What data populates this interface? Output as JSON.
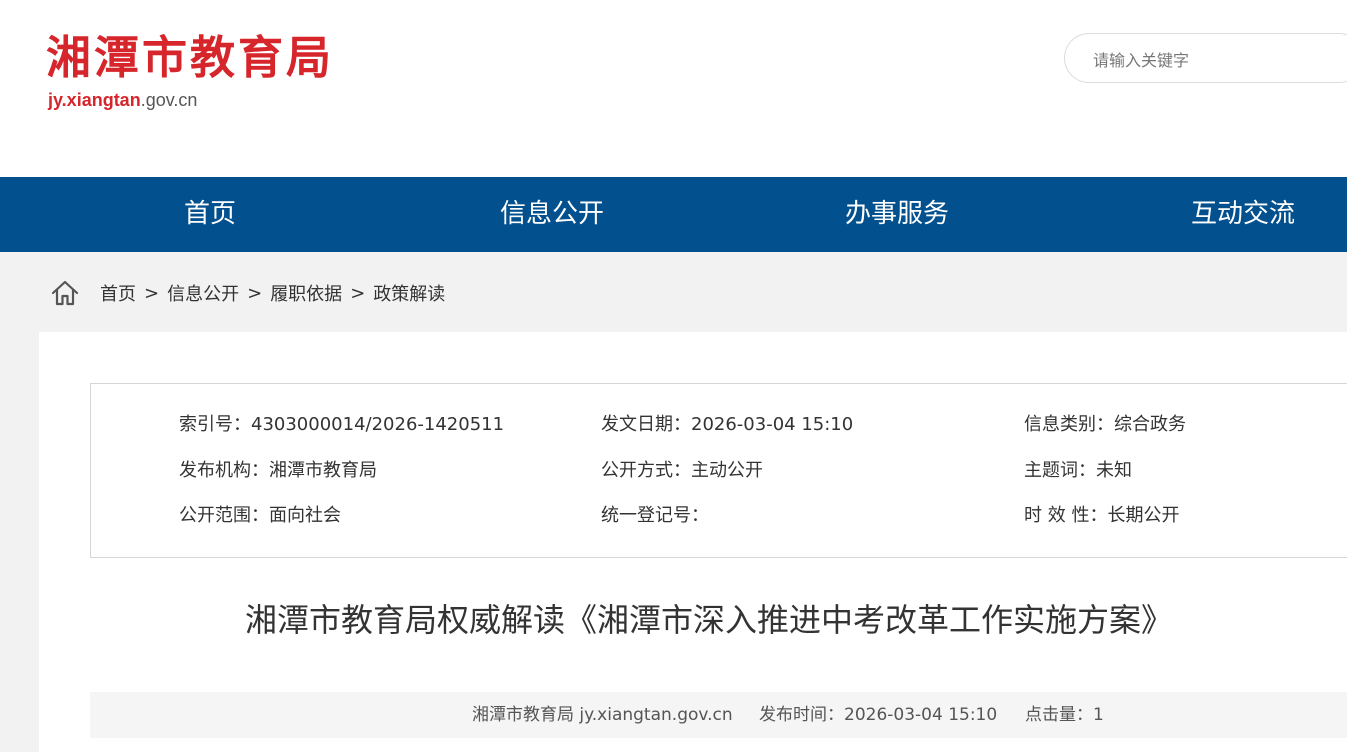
{
  "header": {
    "logo_title": "湘潭市教育局",
    "logo_domain_main": "jy.xiangtan",
    "logo_domain_suffix": ".gov.cn",
    "search_placeholder": "请输入关键字",
    "colors": {
      "brand_red": "#d6262c"
    }
  },
  "nav": {
    "items": [
      {
        "label": "首页"
      },
      {
        "label": "信息公开"
      },
      {
        "label": "办事服务"
      },
      {
        "label": "互动交流"
      }
    ],
    "colors": {
      "background": "#03508f"
    }
  },
  "breadcrumb": {
    "icon": "home-icon",
    "items": [
      "首页",
      "信息公开",
      "履职依据",
      "政策解读"
    ],
    "separator": ">"
  },
  "meta": {
    "index_no": "索引号：4303000014/2026-1420511",
    "publish_date": "发文日期：2026-03-04 15:10",
    "info_category": "信息类别：综合政务",
    "issuing_agency": "发布机构：湘潭市教育局",
    "disclosure_method": "公开方式：主动公开",
    "subject": "主题词：未知",
    "disclosure_scope": "公开范围：面向社会",
    "unified_reg_no": "统一登记号：",
    "validity": "时 效 性：长期公开"
  },
  "article": {
    "title": "湘潭市教育局权威解读《湘潭市深入推进中考改革工作实施方案》",
    "source": "湘潭市教育局 jy.xiangtan.gov.cn",
    "publish_time": "发布时间：2026-03-04 15:10",
    "views": "点击量：1"
  }
}
